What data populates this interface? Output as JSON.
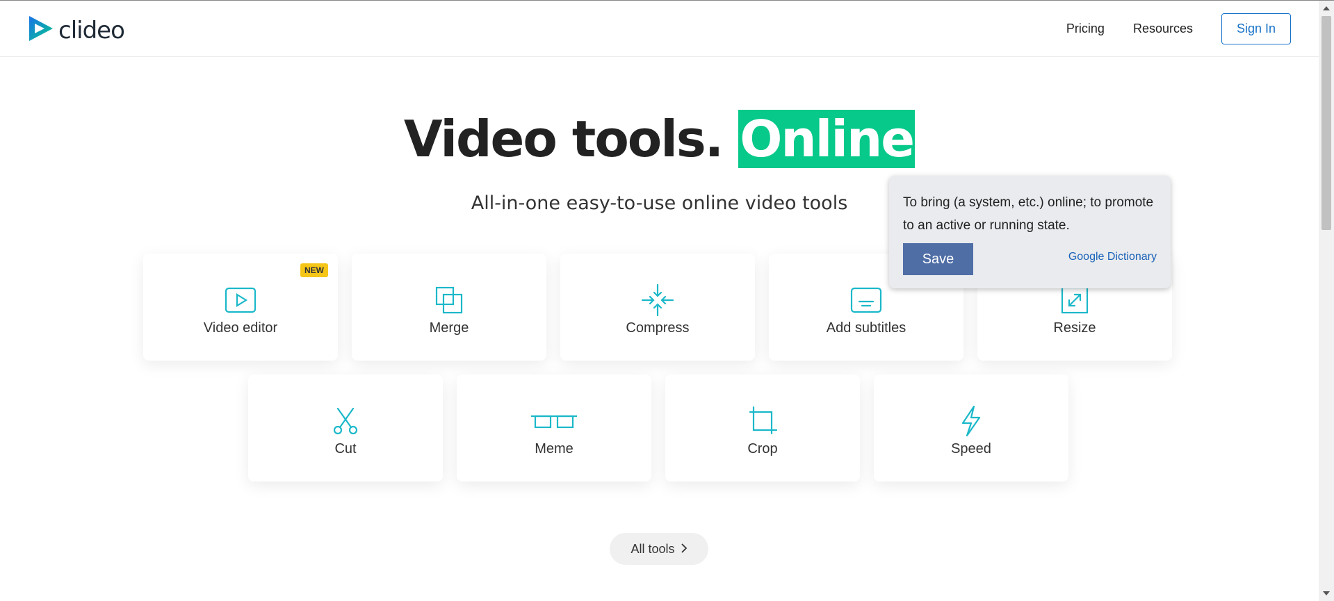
{
  "header": {
    "logo_text": "clideo",
    "nav": [
      "Pricing",
      "Resources"
    ],
    "sign_in": "Sign In"
  },
  "hero": {
    "title_main": "Video tools.",
    "title_highlight": "Online",
    "subtitle": "All-in-one easy-to-use online video tools"
  },
  "tools_row1": [
    {
      "label": "Video editor",
      "icon": "video-play-icon",
      "badge": "NEW"
    },
    {
      "label": "Merge",
      "icon": "merge-icon"
    },
    {
      "label": "Compress",
      "icon": "compress-icon"
    },
    {
      "label": "Add subtitles",
      "icon": "subtitles-icon"
    },
    {
      "label": "Resize",
      "icon": "resize-icon"
    }
  ],
  "tools_row2": [
    {
      "label": "Cut",
      "icon": "scissors-icon"
    },
    {
      "label": "Meme",
      "icon": "meme-glasses-icon"
    },
    {
      "label": "Crop",
      "icon": "crop-icon"
    },
    {
      "label": "Speed",
      "icon": "lightning-icon"
    }
  ],
  "all_tools": "All tools",
  "dictionary_popup": {
    "definition": "To bring (a system, etc.) online; to promote to an active or running state.",
    "save": "Save",
    "source": "Google Dictionary"
  },
  "colors": {
    "accent_green": "#06c98a",
    "icon_teal": "#1bb8c9",
    "link_blue": "#1a73c8",
    "badge_yellow": "#f5c518",
    "save_button": "#4f6ea6"
  }
}
